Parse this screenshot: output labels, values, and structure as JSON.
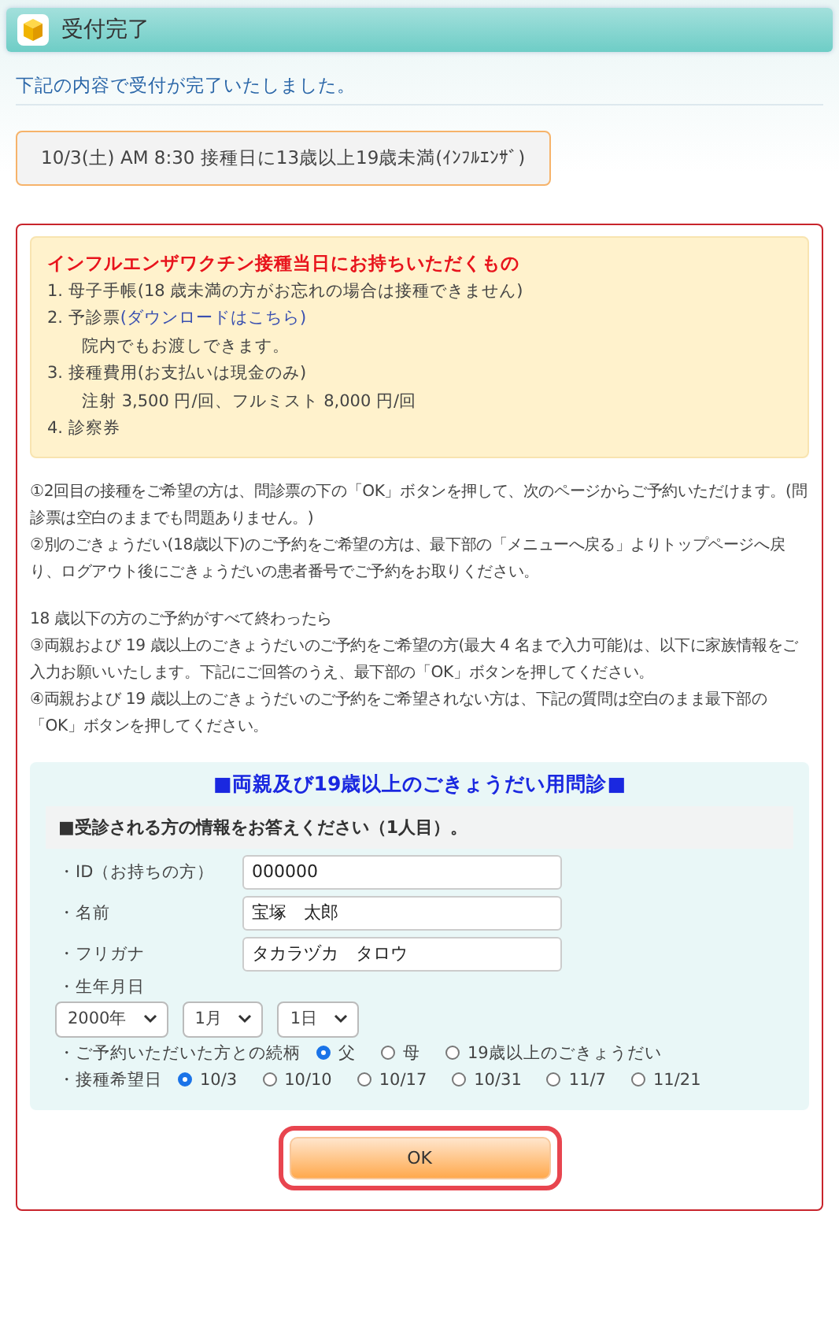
{
  "header": {
    "title": "受付完了"
  },
  "message": "下記の内容で受付が完了いたしました。",
  "appointment": "10/3(土) AM 8:30 接種日に13歳以上19歳未満(ｲﾝﾌﾙｴﾝｻﾞ)",
  "bring_list": {
    "title": "インフルエンザワクチン接種当日にお持ちいただくもの",
    "items": [
      {
        "text": "1. 母子手帳(18 歳未満の方がお忘れの場合は接種できません)"
      },
      {
        "text": "2. 予診票",
        "link": "(ダウンロードはこちら)",
        "subtext": "院内でもお渡しできます。"
      },
      {
        "text": "3. 接種費用(お支払いは現金のみ)",
        "subtext": "注射 3,500 円/回、フルミスト 8,000 円/回"
      },
      {
        "text": "4. 診察券"
      }
    ]
  },
  "notes": [
    [
      "①2回目の接種をご希望の方は、問診票の下の「OK」ボタンを押して、次のページからご予約いただけます。(問診票は空白のままでも問題ありません。)",
      "②別のごきょうだい(18歳以下)のご予約をご希望の方は、最下部の「メニューへ戻る」よりトップページへ戻り、ログアウト後にごきょうだいの患者番号でご予約をお取りください。"
    ],
    [
      "18 歳以下の方のご予約がすべて終わったら",
      "③両親および 19 歳以上のごきょうだいのご予約をご希望の方(最大 4 名まで入力可能)は、以下に家族情報をご入力お願いいたします。下記にご回答のうえ、最下部の「OK」ボタンを押してください。",
      "④両親および 19 歳以上のごきょうだいのご予約をご希望されない方は、下記の質問は空白のまま最下部の「OK」ボタンを押してください。"
    ]
  ],
  "form": {
    "title": "■両親及び19歳以上のごきょうだい用問診■",
    "section": "■受診される方の情報をお答えください（1人目）。",
    "text_fields": [
      {
        "label": "・ID（お持ちの方）",
        "value": "000000"
      },
      {
        "label": "・名前",
        "value": "宝塚　太郎"
      },
      {
        "label": "・フリガナ",
        "value": "タカラヅカ　タロウ"
      }
    ],
    "birthdate": {
      "label": "・生年月日",
      "selects": [
        "2000年",
        "1月",
        "1日"
      ]
    },
    "radio_groups": [
      {
        "label": "・ご予約いただいた方との続柄",
        "options": [
          {
            "label": "父",
            "selected": true
          },
          {
            "label": "母",
            "selected": false
          },
          {
            "label": "19歳以上のごきょうだい",
            "selected": false
          }
        ]
      },
      {
        "label": "・接種希望日",
        "options": [
          {
            "label": "10/3",
            "selected": true
          },
          {
            "label": "10/10",
            "selected": false
          },
          {
            "label": "10/17",
            "selected": false
          },
          {
            "label": "10/31",
            "selected": false
          },
          {
            "label": "11/7",
            "selected": false
          },
          {
            "label": "11/21",
            "selected": false
          }
        ]
      }
    ]
  },
  "ok_button": "OK"
}
